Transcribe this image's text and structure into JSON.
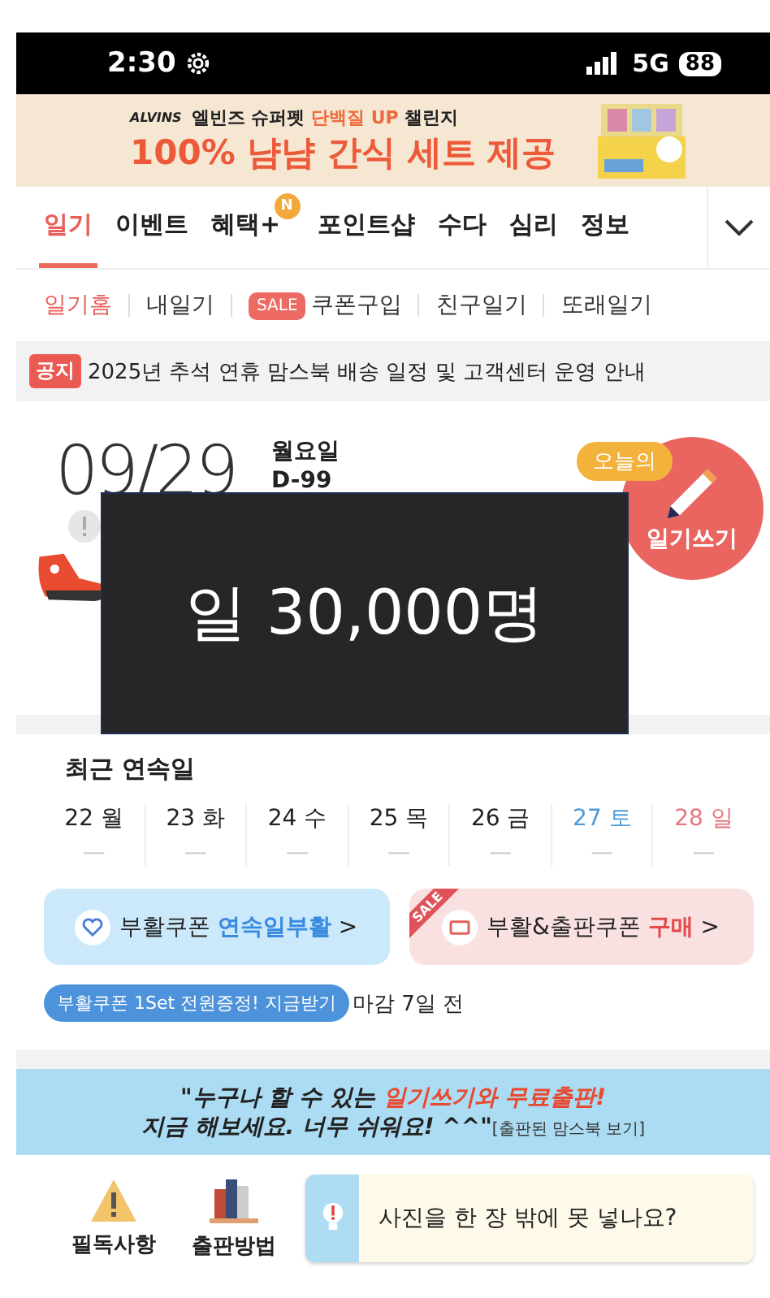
{
  "status_bar": {
    "time": "2:30",
    "network": "5G",
    "battery": "88"
  },
  "ad_banner": {
    "brand": "ALVINS",
    "line1_prefix": "엘빈즈 슈퍼펫",
    "line1_highlight": "단백질 UP",
    "line1_suffix": "챌린지",
    "headline": "100% 냠냠 간식 세트 제공"
  },
  "tabs": [
    {
      "label": "일기",
      "selected": true
    },
    {
      "label": "이벤트",
      "selected": false
    },
    {
      "label": "혜택+",
      "selected": false,
      "badge": "N"
    },
    {
      "label": "포인트샵",
      "selected": false
    },
    {
      "label": "수다",
      "selected": false
    },
    {
      "label": "심리",
      "selected": false
    },
    {
      "label": "정보",
      "selected": false
    }
  ],
  "sub_nav": [
    {
      "label": "일기홈",
      "selected": true
    },
    {
      "label": "내일기",
      "selected": false
    },
    {
      "label": "쿠폰구입",
      "selected": false,
      "tag": "SALE"
    },
    {
      "label": "친구일기",
      "selected": false
    },
    {
      "label": "또래일기",
      "selected": false
    }
  ],
  "notice": {
    "tag": "공지",
    "text": "2025년 추석 연휴 맘스북 배송 일정 및 고객센터 운영 안내"
  },
  "today": {
    "date": "09/29",
    "weekday": "월요일",
    "dday": "D-99",
    "write_badge": "오늘의",
    "write_label": "일기쓰기"
  },
  "overlay": {
    "text": "일 30,000명"
  },
  "streak": {
    "title": "최근 연속일",
    "days": [
      {
        "date": "22",
        "day": "월",
        "kind": "weekday",
        "mark": "—"
      },
      {
        "date": "23",
        "day": "화",
        "kind": "weekday",
        "mark": "—"
      },
      {
        "date": "24",
        "day": "수",
        "kind": "weekday",
        "mark": "—"
      },
      {
        "date": "25",
        "day": "목",
        "kind": "weekday",
        "mark": "—"
      },
      {
        "date": "26",
        "day": "금",
        "kind": "weekday",
        "mark": "—"
      },
      {
        "date": "27",
        "day": "토",
        "kind": "saturday",
        "mark": "—"
      },
      {
        "date": "28",
        "day": "일",
        "kind": "sunday",
        "mark": "—"
      }
    ]
  },
  "coupons": [
    {
      "kind": "revive",
      "label": "부활쿠폰",
      "action": "연속일부활",
      "arrow": ">"
    },
    {
      "kind": "buy",
      "label": "부활&출판쿠폰",
      "action": "구매",
      "arrow": ">",
      "ribbon": "SALE"
    }
  ],
  "promo": {
    "pill": "부활쿠폰 1Set 전원증정! 지금받기",
    "deadline": "마감 7일 전"
  },
  "slogan": {
    "line1_prefix": "\"누구나 할 수 있는",
    "line1_highlight": "일기쓰기와 무료출판!",
    "line2": "지금 해보세요. 너무 쉬워요! ^^\"",
    "link": "[출판된 맘스북 보기]"
  },
  "shortcuts": [
    {
      "kind": "warning",
      "label": "필독사항"
    },
    {
      "kind": "books",
      "label": "출판방법"
    }
  ],
  "tip": {
    "text": "사진을 한 장 밖에 못 넣나요?"
  }
}
